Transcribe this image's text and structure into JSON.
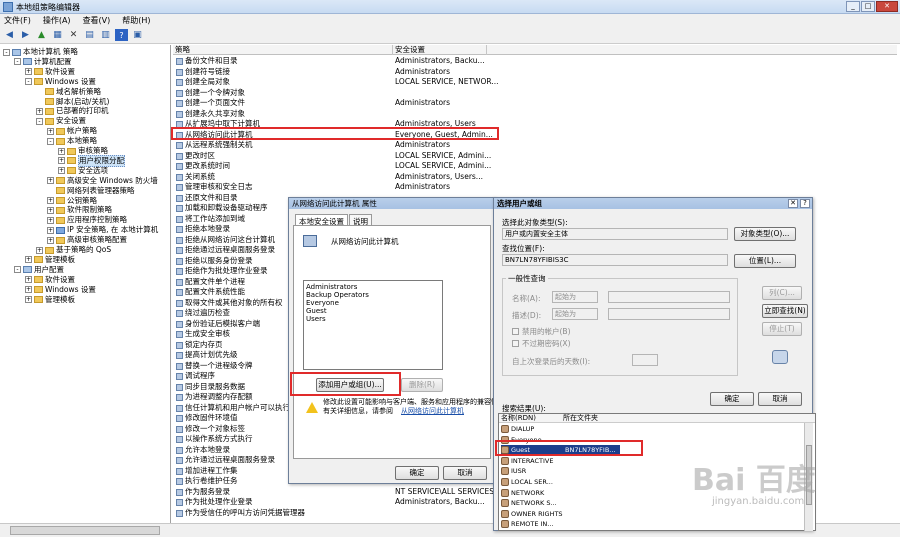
{
  "window": {
    "title": "本地组策略编辑器"
  },
  "menu": [
    "文件(F)",
    "操作(A)",
    "查看(V)",
    "帮助(H)"
  ],
  "tree": [
    {
      "label": "本地计算机 策略",
      "indent": 0,
      "expander": "-",
      "icon": "pc"
    },
    {
      "label": "计算机配置",
      "indent": 1,
      "expander": "-",
      "icon": "pc"
    },
    {
      "label": "软件设置",
      "indent": 2,
      "expander": "+",
      "icon": "folder"
    },
    {
      "label": "Windows 设置",
      "indent": 2,
      "expander": "-",
      "icon": "folder"
    },
    {
      "label": "域名解析策略",
      "indent": 3,
      "expander": "",
      "icon": "folder"
    },
    {
      "label": "脚本(启动/关机)",
      "indent": 3,
      "expander": "",
      "icon": "folder"
    },
    {
      "label": "已部署的打印机",
      "indent": 3,
      "expander": "+",
      "icon": "folder"
    },
    {
      "label": "安全设置",
      "indent": 3,
      "expander": "-",
      "icon": "folder"
    },
    {
      "label": "帐户策略",
      "indent": 4,
      "expander": "+",
      "icon": "folder"
    },
    {
      "label": "本地策略",
      "indent": 4,
      "expander": "-",
      "icon": "folder"
    },
    {
      "label": "审核策略",
      "indent": 5,
      "expander": "+",
      "icon": "folder"
    },
    {
      "label": "用户权限分配",
      "indent": 5,
      "expander": "+",
      "icon": "folder",
      "selected": true
    },
    {
      "label": "安全选项",
      "indent": 5,
      "expander": "+",
      "icon": "folder"
    },
    {
      "label": "高级安全 Windows 防火墙",
      "indent": 4,
      "expander": "+",
      "icon": "folder"
    },
    {
      "label": "网络列表管理器策略",
      "indent": 4,
      "expander": "",
      "icon": "folder"
    },
    {
      "label": "公钥策略",
      "indent": 4,
      "expander": "+",
      "icon": "folder"
    },
    {
      "label": "软件限制策略",
      "indent": 4,
      "expander": "+",
      "icon": "folder"
    },
    {
      "label": "应用程序控制策略",
      "indent": 4,
      "expander": "+",
      "icon": "folder"
    },
    {
      "label": "IP 安全策略, 在 本地计算机",
      "indent": 4,
      "expander": "+",
      "icon": "blue"
    },
    {
      "label": "高级审核策略配置",
      "indent": 4,
      "expander": "+",
      "icon": "folder"
    },
    {
      "label": "基于策略的 QoS",
      "indent": 3,
      "expander": "+",
      "icon": "folder"
    },
    {
      "label": "管理模板",
      "indent": 2,
      "expander": "+",
      "icon": "folder"
    },
    {
      "label": "用户配置",
      "indent": 1,
      "expander": "-",
      "icon": "pc"
    },
    {
      "label": "软件设置",
      "indent": 2,
      "expander": "+",
      "icon": "folder"
    },
    {
      "label": "Windows 设置",
      "indent": 2,
      "expander": "+",
      "icon": "folder"
    },
    {
      "label": "管理模板",
      "indent": 2,
      "expander": "+",
      "icon": "folder"
    }
  ],
  "columns": {
    "policy": "策略",
    "setting": "安全设置"
  },
  "policies": [
    [
      "备份文件和目录",
      "Administrators, Backu..."
    ],
    [
      "创建符号链接",
      "Administrators"
    ],
    [
      "创建全局对象",
      "LOCAL SERVICE, NETWOR..."
    ],
    [
      "创建一个令牌对象",
      ""
    ],
    [
      "创建一个页面文件",
      "Administrators"
    ],
    [
      "创建永久共享对象",
      ""
    ],
    [
      "从扩展坞中取下计算机",
      "Administrators, Users"
    ],
    [
      "从网络访问此计算机",
      "Everyone, Guest, Admin..."
    ],
    [
      "从远程系统强制关机",
      "Administrators"
    ],
    [
      "更改时区",
      "LOCAL SERVICE, Admini..."
    ],
    [
      "更改系统时间",
      "LOCAL SERVICE, Admini..."
    ],
    [
      "关闭系统",
      "Administrators, Users..."
    ],
    [
      "管理审核和安全日志",
      "Administrators"
    ],
    [
      "还原文件和目录",
      ""
    ],
    [
      "加载和卸载设备驱动程序",
      ""
    ],
    [
      "将工作站添加到域",
      ""
    ],
    [
      "拒绝本地登录",
      ""
    ],
    [
      "拒绝从网络访问这台计算机",
      ""
    ],
    [
      "拒绝通过远程桌面服务登录",
      ""
    ],
    [
      "拒绝以服务身份登录",
      ""
    ],
    [
      "拒绝作为批处理作业登录",
      ""
    ],
    [
      "配置文件单个进程",
      ""
    ],
    [
      "配置文件系统性能",
      ""
    ],
    [
      "取得文件或其他对象的所有权",
      ""
    ],
    [
      "绕过遍历检查",
      ""
    ],
    [
      "身份验证后模拟客户端",
      ""
    ],
    [
      "生成安全审核",
      ""
    ],
    [
      "锁定内存页",
      ""
    ],
    [
      "提高计划优先级",
      ""
    ],
    [
      "替换一个进程级令牌",
      ""
    ],
    [
      "调试程序",
      ""
    ],
    [
      "同步目录服务数据",
      ""
    ],
    [
      "为进程调整内存配额",
      ""
    ],
    [
      "信任计算机和用户帐户可以执行委派",
      ""
    ],
    [
      "修改固件环境值",
      ""
    ],
    [
      "修改一个对象标签",
      ""
    ],
    [
      "以操作系统方式执行",
      ""
    ],
    [
      "允许本地登录",
      ""
    ],
    [
      "允许通过远程桌面服务登录",
      ""
    ],
    [
      "增加进程工作集",
      ""
    ],
    [
      "执行卷维护任务",
      ""
    ],
    [
      "作为服务登录",
      "NT SERVICE\\ALL SERVICES"
    ],
    [
      "作为批处理作业登录",
      "Administrators, Backu..."
    ],
    [
      "作为受信任的呼叫方访问凭据管理器",
      ""
    ]
  ],
  "props_dialog": {
    "title": "从网络访问此计算机 属性",
    "tabs": [
      "本地安全设置",
      "说明"
    ],
    "policy_name": "从网络访问此计算机",
    "members": [
      "Administrators",
      "Backup Operators",
      "Everyone",
      "Guest",
      "Users"
    ],
    "add_button": "添加用户或组(U)...",
    "remove_button": "删除(R)",
    "warning_text": "修改此设置可能影响与客户端、服务和应用程序的兼容性。",
    "warning_text2": "有关详细信息，请参阅",
    "warning_link": "从网络访问此计算机",
    "ok": "确定",
    "cancel": "取消"
  },
  "select_dialog": {
    "title": "选择用户或组",
    "object_type_label": "选择此对象类型(S):",
    "object_type_value": "用户或内置安全主体",
    "object_type_button": "对象类型(O)...",
    "location_label": "查找位置(F):",
    "location_value": "BN7LN78YFIBIS3C",
    "location_button": "位置(L)...",
    "group_title": "一般性查询",
    "name_label": "名称(A):",
    "desc_label": "描述(D):",
    "starts_with": "起始为",
    "disabled_accounts": "禁用的帐户(B)",
    "no_expire": "不过期密码(X)",
    "days_label": "自上次登录后的天数(I):",
    "columns_button": "列(C)...",
    "find_now": "立即查找(N)",
    "stop": "停止(T)",
    "results_label": "搜索结果(U):",
    "ok": "确定",
    "cancel": "取消",
    "results_columns": [
      "名称(RDN)",
      "所在文件夹"
    ],
    "results": [
      {
        "name": "DIALUP",
        "folder": ""
      },
      {
        "name": "Everyone",
        "folder": ""
      },
      {
        "name": "Guest",
        "folder": "BN7LN78YFIB...",
        "selected": true
      },
      {
        "name": "INTERACTIVE",
        "folder": ""
      },
      {
        "name": "IUSR",
        "folder": ""
      },
      {
        "name": "LOCAL SER...",
        "folder": ""
      },
      {
        "name": "NETWORK",
        "folder": ""
      },
      {
        "name": "NETWORK S...",
        "folder": ""
      },
      {
        "name": "OWNER RIGHTS",
        "folder": ""
      },
      {
        "name": "REMOTE IN...",
        "folder": ""
      }
    ]
  },
  "watermark": {
    "brand": "Bai 百度",
    "site": "jingyan.baidu.com"
  }
}
